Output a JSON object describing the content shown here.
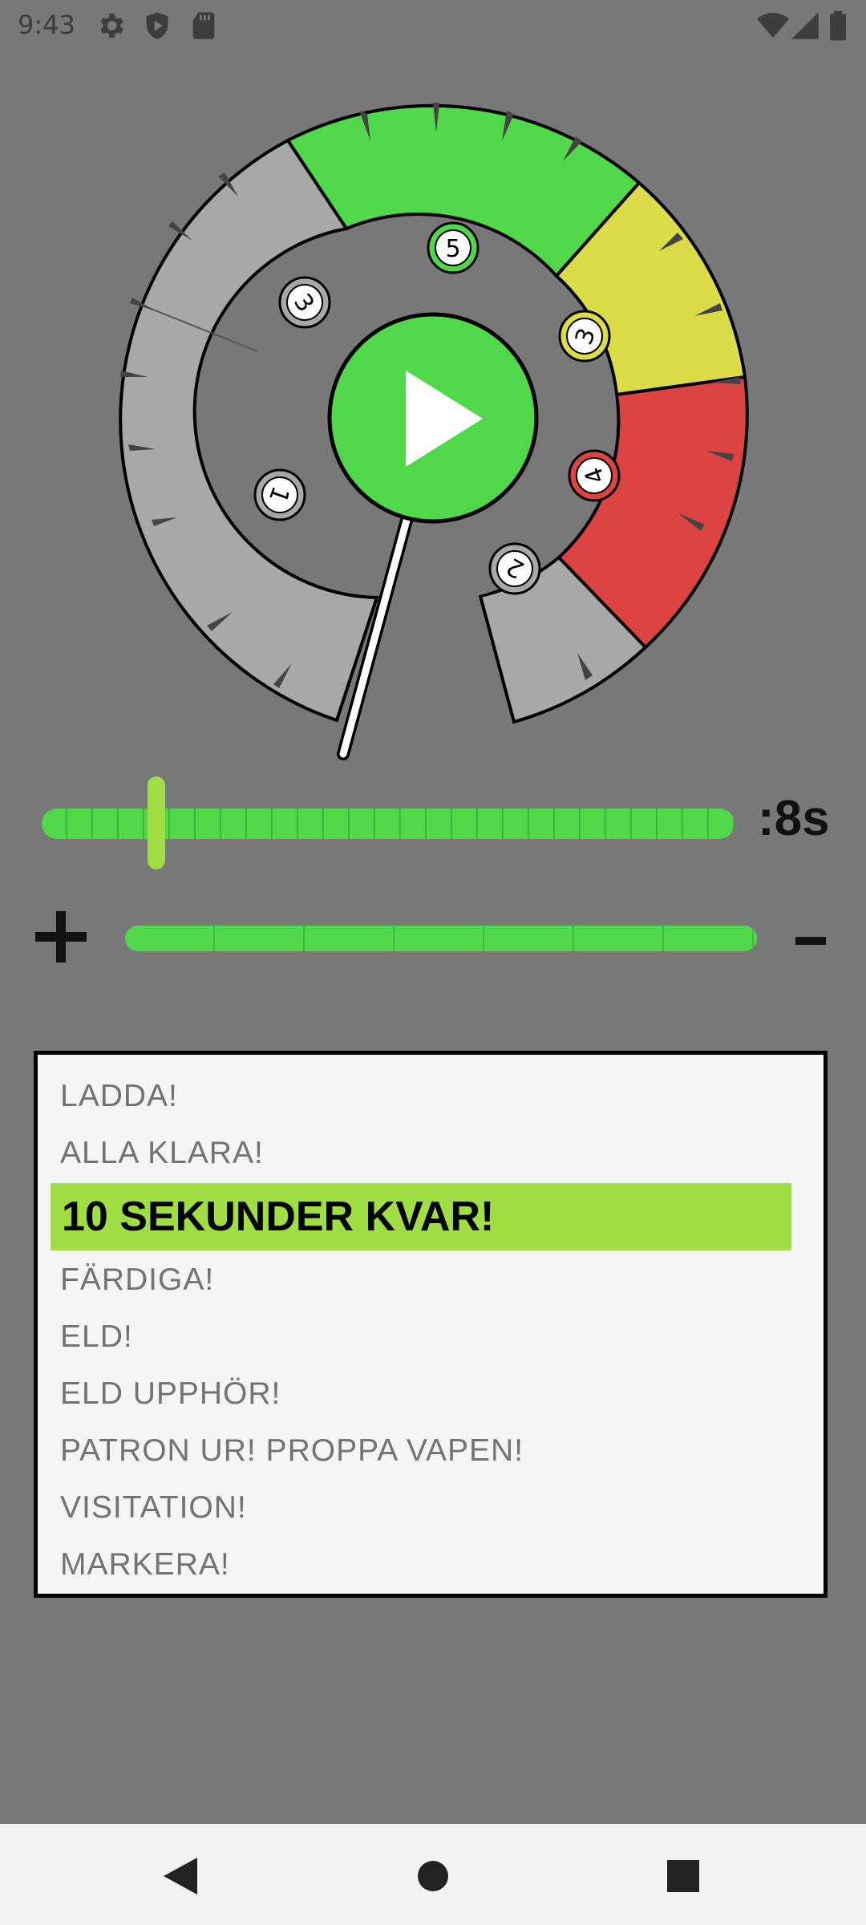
{
  "status_bar": {
    "time": "9:43",
    "icons": [
      "settings-icon",
      "shield-icon",
      "sd-card-icon",
      "wifi-icon",
      "cellular-signal-icon",
      "battery-icon"
    ]
  },
  "dial": {
    "play_icon": "play-icon",
    "markers": [
      "5",
      "3",
      "3",
      "4",
      "1",
      "2"
    ],
    "colors": {
      "green": "#50d84a",
      "yellow": "#dcdc48",
      "red": "#dc4444",
      "gray": "#a8a8a8",
      "background": "#787878"
    }
  },
  "timer": {
    "value_label": ":8s",
    "slider_level": 0.17,
    "plus_icon": "plus-icon",
    "minus_icon": "minus-icon"
  },
  "commands": {
    "items": [
      "LADDA!",
      "ALLA KLARA!",
      "10 SEKUNDER KVAR!",
      "FÄRDIGA!",
      "ELD!",
      "ELD UPPHÖR!",
      "PATRON UR! PROPPA VAPEN!",
      "VISITATION!",
      "MARKERA!"
    ],
    "selected_index": 2,
    "highlight_color": "#9fdf44"
  },
  "nav_bar": {
    "icons": [
      "back-icon",
      "home-icon",
      "recents-icon"
    ]
  }
}
